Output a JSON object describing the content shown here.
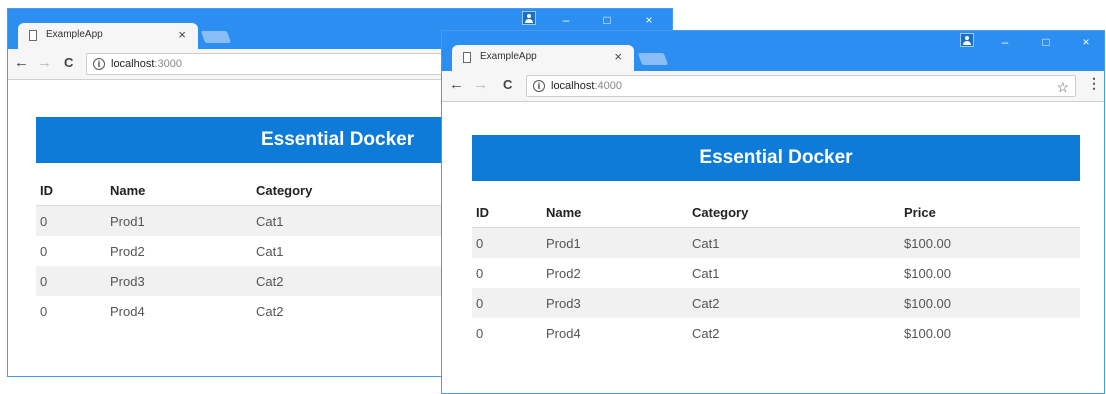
{
  "windows": [
    {
      "tab_title": "ExampleApp",
      "tab_close": "×",
      "url_host": "localhost",
      "url_port": ":3000",
      "banner": "Essential Docker",
      "columns": [
        "ID",
        "Name",
        "Category"
      ],
      "rows": [
        [
          "0",
          "Prod1",
          "Cat1"
        ],
        [
          "0",
          "Prod2",
          "Cat1"
        ],
        [
          "0",
          "Prod3",
          "Cat2"
        ],
        [
          "0",
          "Prod4",
          "Cat2"
        ]
      ]
    },
    {
      "tab_title": "ExampleApp",
      "tab_close": "×",
      "url_host": "localhost",
      "url_port": ":4000",
      "banner": "Essential Docker",
      "columns": [
        "ID",
        "Name",
        "Category",
        "Price"
      ],
      "rows": [
        [
          "0",
          "Prod1",
          "Cat1",
          "$100.00"
        ],
        [
          "0",
          "Prod2",
          "Cat1",
          "$100.00"
        ],
        [
          "0",
          "Prod3",
          "Cat2",
          "$100.00"
        ],
        [
          "0",
          "Prod4",
          "Cat2",
          "$100.00"
        ]
      ]
    }
  ],
  "controls": {
    "back": "←",
    "forward": "→",
    "reload": "C",
    "info": "i",
    "star": "☆",
    "menu": "⋮",
    "minimize": "–",
    "maximize": "□",
    "close": "×"
  },
  "icons": [
    "page-icon",
    "close-icon",
    "back-arrow-icon",
    "forward-arrow-icon",
    "reload-icon",
    "info-icon",
    "star-icon",
    "menu-icon",
    "profile-icon"
  ],
  "colors": {
    "titlebar": "#2b8ef0",
    "banner": "#0f7bd9",
    "stripe": "#f1f1f1"
  }
}
